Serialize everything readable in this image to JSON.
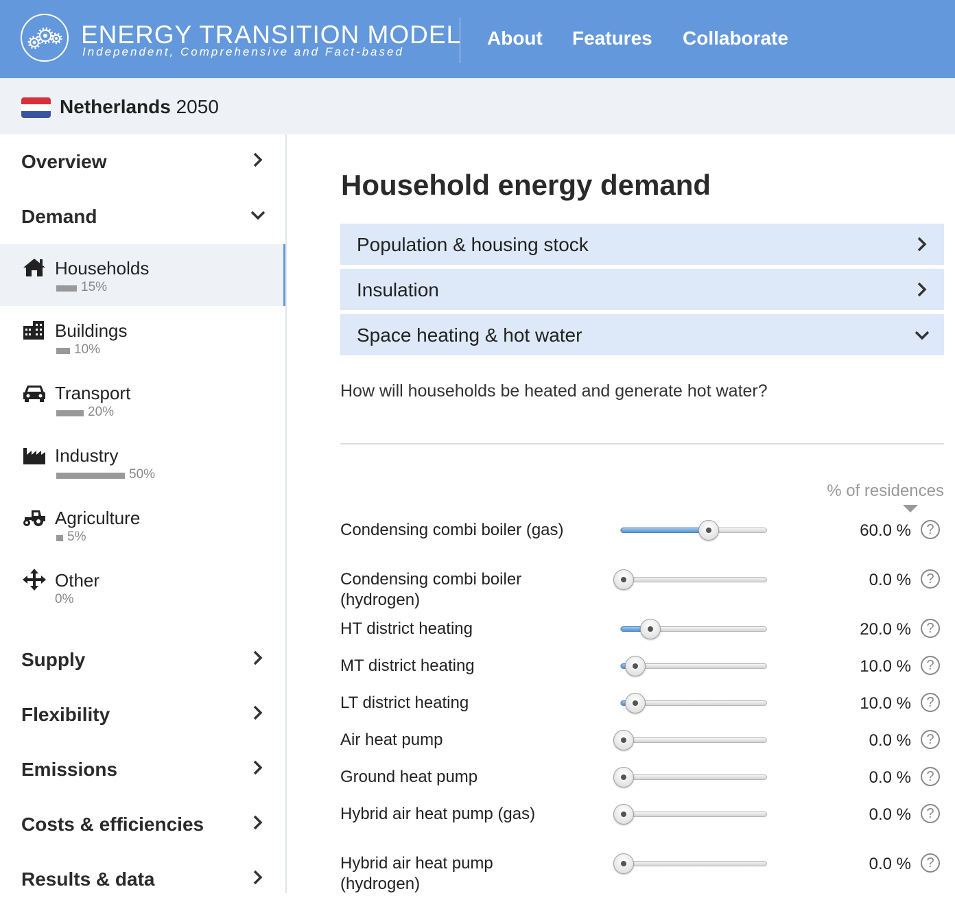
{
  "header": {
    "title": "ENERGY TRANSITION MODEL",
    "tagline": "Independent, Comprehensive and Fact-based",
    "nav": [
      "About",
      "Features",
      "Collaborate"
    ],
    "color": "#6498dc"
  },
  "region": {
    "name": "Netherlands",
    "year": "2050"
  },
  "sidebar": {
    "sections": {
      "overview": "Overview",
      "demand": "Demand",
      "supply": "Supply",
      "flexibility": "Flexibility",
      "emissions": "Emissions",
      "costs": "Costs & efficiencies",
      "results": "Results & data"
    },
    "demand_items": [
      {
        "label": "Households",
        "pct": "15%",
        "icon": "house-icon",
        "active": true
      },
      {
        "label": "Buildings",
        "pct": "10%",
        "icon": "buildings-icon"
      },
      {
        "label": "Transport",
        "pct": "20%",
        "icon": "car-icon"
      },
      {
        "label": "Industry",
        "pct": "50%",
        "icon": "factory-icon"
      },
      {
        "label": "Agriculture",
        "pct": "5%",
        "icon": "tractor-icon"
      },
      {
        "label": "Other",
        "pct": "0%",
        "icon": "move-arrows-icon"
      }
    ]
  },
  "main": {
    "title": "Household energy demand",
    "accordions": [
      {
        "label": "Population & housing stock",
        "expanded": false
      },
      {
        "label": "Insulation",
        "expanded": false
      },
      {
        "label": "Space heating & hot water",
        "expanded": true
      }
    ],
    "question": "How will households be heated and generate hot water?",
    "unit_label": "% of residences",
    "sliders": [
      {
        "label": "Condensing combi boiler (gas)",
        "value": "60.0 %",
        "fraction": 0.6
      },
      {
        "label": "Condensing combi boiler (hydrogen)",
        "value": "0.0 %",
        "fraction": 0.0
      },
      {
        "label": "HT district heating",
        "value": "20.0 %",
        "fraction": 0.2
      },
      {
        "label": "MT district heating",
        "value": "10.0 %",
        "fraction": 0.1
      },
      {
        "label": "LT district heating",
        "value": "10.0 %",
        "fraction": 0.1
      },
      {
        "label": "Air heat pump",
        "value": "0.0 %",
        "fraction": 0.0
      },
      {
        "label": "Ground heat pump",
        "value": "0.0 %",
        "fraction": 0.0
      },
      {
        "label": "Hybrid air heat pump (gas)",
        "value": "0.0 %",
        "fraction": 0.0
      },
      {
        "label": "Hybrid air heat pump (hydrogen)",
        "value": "0.0 %",
        "fraction": 0.0
      }
    ],
    "help_glyph": "?"
  }
}
